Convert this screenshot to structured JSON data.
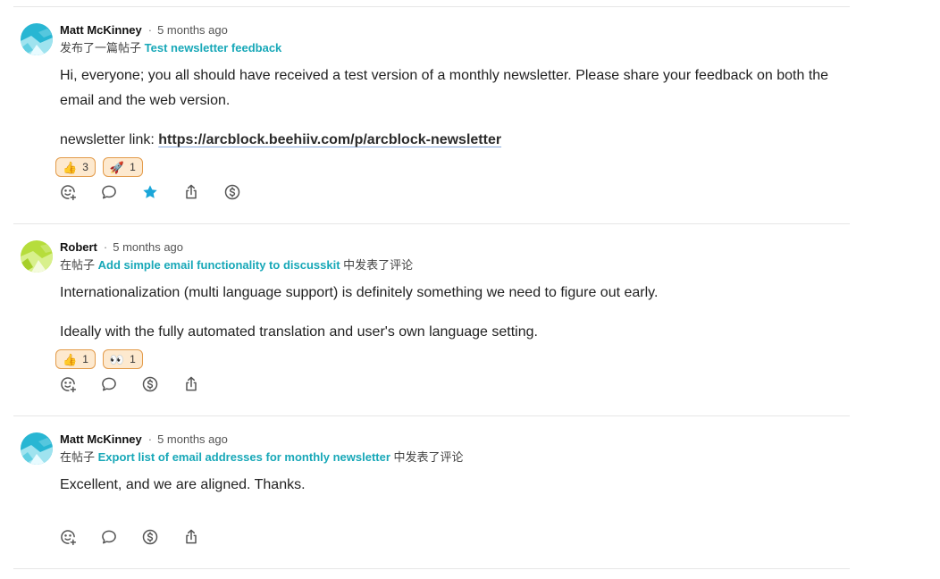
{
  "posts": [
    {
      "author": "Matt McKinney",
      "time": "5 months ago",
      "meta_prefix": "发布了一篇帖子",
      "meta_link": "Test newsletter feedback",
      "meta_suffix": "",
      "paragraph1": "Hi, everyone; you all should have received a test version of a monthly newsletter. Please share your feedback on both the email and the web version.",
      "paragraph2_prefix": "newsletter link: ",
      "paragraph2_link": "https://arcblock.beehiiv.com/p/arcblock-newsletter",
      "reactions": [
        {
          "emoji": "👍",
          "count": "3"
        },
        {
          "emoji": "🚀",
          "count": "1"
        }
      ],
      "actions": [
        "add-reaction-icon",
        "comment-icon",
        "star-icon",
        "share-icon",
        "tip-dollar-icon"
      ],
      "starred": true
    },
    {
      "author": "Robert",
      "time": "5 months ago",
      "meta_prefix": "在帖子",
      "meta_link": "Add simple email functionality to discusskit",
      "meta_suffix": "中发表了评论",
      "paragraph1": "Internationalization (multi language support) is definitely something we need to figure out early.",
      "paragraph2": "Ideally with the fully automated translation and user's own language setting.",
      "reactions": [
        {
          "emoji": "👍",
          "count": "1"
        },
        {
          "emoji": "👀",
          "count": "1"
        }
      ],
      "actions": [
        "add-reaction-icon",
        "comment-icon",
        "tip-dollar-icon",
        "share-icon"
      ]
    },
    {
      "author": "Matt McKinney",
      "time": "5 months ago",
      "meta_prefix": "在帖子",
      "meta_link": "Export list of email addresses for monthly newsletter",
      "meta_suffix": "中发表了评论",
      "paragraph1": "Excellent, and we are aligned. Thanks.",
      "actions": [
        "add-reaction-icon",
        "comment-icon",
        "tip-dollar-icon",
        "share-icon"
      ]
    }
  ],
  "colors": {
    "link": "#18a8b8",
    "star": "#1aa6d9",
    "chip_border": "#e39b4a",
    "chip_bg": "#fde9cf"
  }
}
